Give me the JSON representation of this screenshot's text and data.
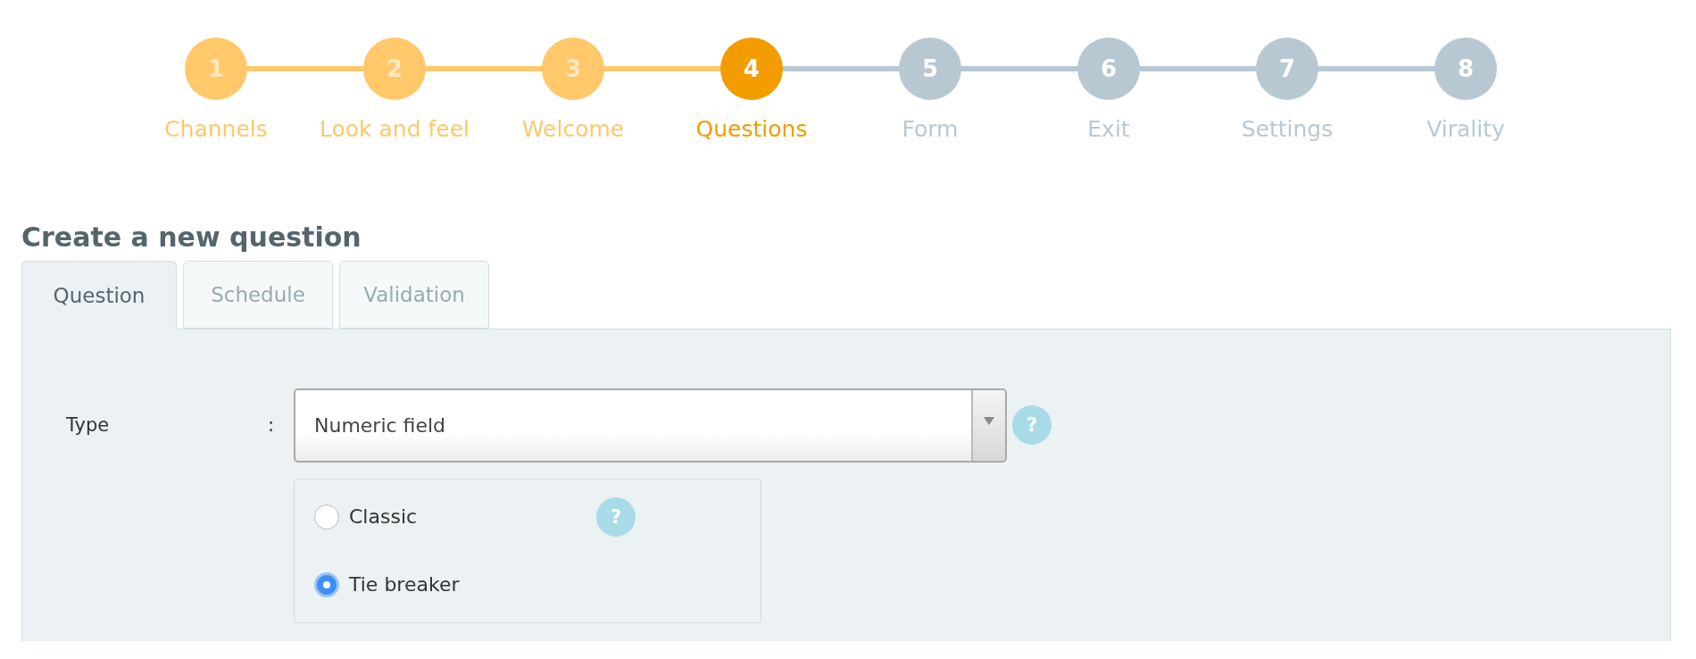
{
  "steps": [
    {
      "number": "1",
      "label": "Channels",
      "completed": true,
      "selected": false
    },
    {
      "number": "2",
      "label": "Look and feel",
      "completed": true,
      "selected": false
    },
    {
      "number": "3",
      "label": "Welcome",
      "completed": true,
      "selected": false
    },
    {
      "number": "4",
      "label": "Questions",
      "completed": false,
      "selected": true
    },
    {
      "number": "5",
      "label": "Form",
      "completed": false,
      "selected": false
    },
    {
      "number": "6",
      "label": "Exit",
      "completed": false,
      "selected": false
    },
    {
      "number": "7",
      "label": "Settings",
      "completed": false,
      "selected": false
    },
    {
      "number": "8",
      "label": "Virality",
      "completed": false,
      "selected": false
    }
  ],
  "heading": "Create a new question",
  "tabs": [
    {
      "label": "Question",
      "selected": true
    },
    {
      "label": "Schedule",
      "selected": false
    },
    {
      "label": "Validation",
      "selected": false
    }
  ],
  "form": {
    "type_field": {
      "label": "Type",
      "separator": ":",
      "value": "Numeric field",
      "help": "?"
    },
    "options": [
      {
        "label": "Classic",
        "selected": false,
        "help": "?"
      },
      {
        "label": "Tie breaker",
        "selected": true
      }
    ]
  }
}
